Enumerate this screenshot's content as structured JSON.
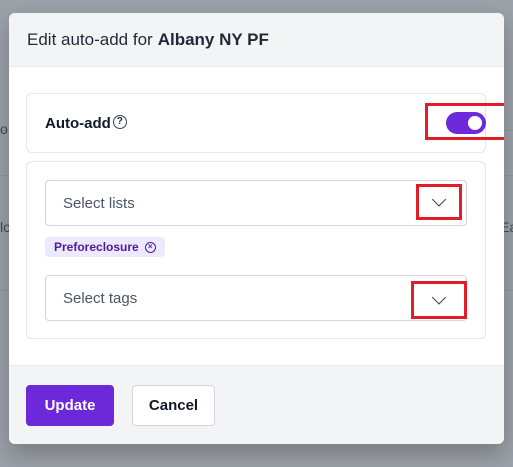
{
  "background": {
    "left_fragments": [
      "o",
      "lo"
    ],
    "right_fragments": [
      "Ea"
    ]
  },
  "modal": {
    "title_prefix": "Edit auto-add for",
    "title_name": "Albany NY PF"
  },
  "auto_add": {
    "label": "Auto-add",
    "help_glyph": "?",
    "enabled": true
  },
  "lists_select": {
    "placeholder": "Select lists",
    "selected_tags": [
      {
        "label": "Preforeclosure",
        "remove_glyph": "×"
      }
    ]
  },
  "tags_select": {
    "placeholder": "Select tags"
  },
  "footer": {
    "update_label": "Update",
    "cancel_label": "Cancel"
  },
  "colors": {
    "accent": "#6d28d9",
    "highlight_box": "#e11d2a",
    "chip_bg": "#ede9fe"
  }
}
